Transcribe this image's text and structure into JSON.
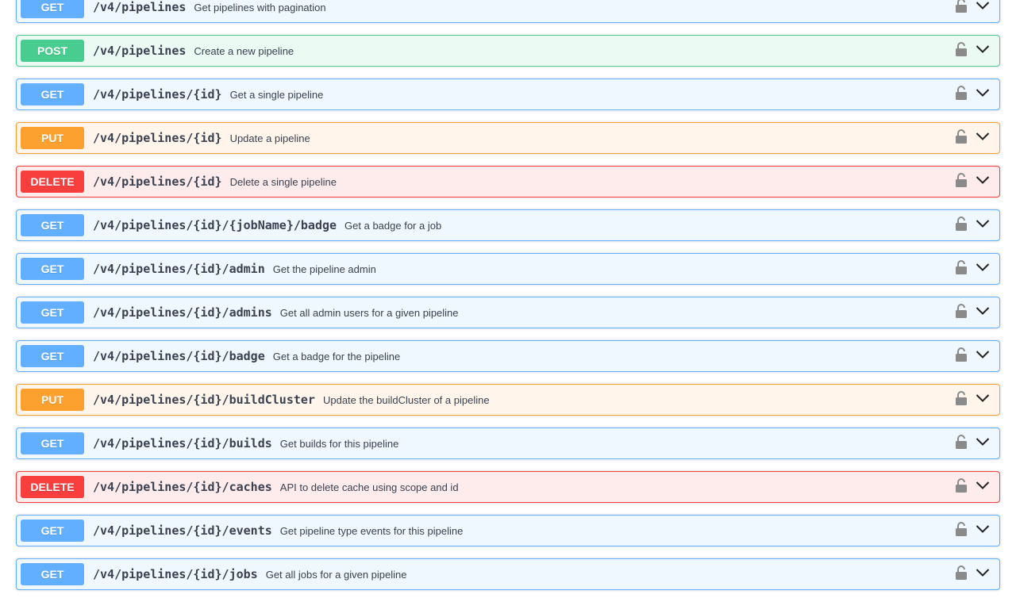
{
  "operations": [
    {
      "method": "GET",
      "path": "/v4/pipelines",
      "summary": "Get pipelines with pagination",
      "lock_icon": "unlocked-icon",
      "expand_icon": "chevron-down-icon"
    },
    {
      "method": "POST",
      "path": "/v4/pipelines",
      "summary": "Create a new pipeline",
      "lock_icon": "unlocked-icon",
      "expand_icon": "chevron-down-icon"
    },
    {
      "method": "GET",
      "path": "/v4/pipelines/{id}",
      "summary": "Get a single pipeline",
      "lock_icon": "unlocked-icon",
      "expand_icon": "chevron-down-icon"
    },
    {
      "method": "PUT",
      "path": "/v4/pipelines/{id}",
      "summary": "Update a pipeline",
      "lock_icon": "unlocked-icon",
      "expand_icon": "chevron-down-icon"
    },
    {
      "method": "DELETE",
      "path": "/v4/pipelines/{id}",
      "summary": "Delete a single pipeline",
      "lock_icon": "unlocked-icon",
      "expand_icon": "chevron-down-icon"
    },
    {
      "method": "GET",
      "path": "/v4/pipelines/{id}/{jobName}/badge",
      "summary": "Get a badge for a job",
      "lock_icon": "unlocked-icon",
      "expand_icon": "chevron-down-icon"
    },
    {
      "method": "GET",
      "path": "/v4/pipelines/{id}/admin",
      "summary": "Get the pipeline admin",
      "lock_icon": "unlocked-icon",
      "expand_icon": "chevron-down-icon"
    },
    {
      "method": "GET",
      "path": "/v4/pipelines/{id}/admins",
      "summary": "Get all admin users for a given pipeline",
      "lock_icon": "unlocked-icon",
      "expand_icon": "chevron-down-icon"
    },
    {
      "method": "GET",
      "path": "/v4/pipelines/{id}/badge",
      "summary": "Get a badge for the pipeline",
      "lock_icon": "unlocked-icon",
      "expand_icon": "chevron-down-icon"
    },
    {
      "method": "PUT",
      "path": "/v4/pipelines/{id}/buildCluster",
      "summary": "Update the buildCluster of a pipeline",
      "lock_icon": "unlocked-icon",
      "expand_icon": "chevron-down-icon"
    },
    {
      "method": "GET",
      "path": "/v4/pipelines/{id}/builds",
      "summary": "Get builds for this pipeline",
      "lock_icon": "unlocked-icon",
      "expand_icon": "chevron-down-icon"
    },
    {
      "method": "DELETE",
      "path": "/v4/pipelines/{id}/caches",
      "summary": "API to delete cache using scope and id",
      "lock_icon": "unlocked-icon",
      "expand_icon": "chevron-down-icon"
    },
    {
      "method": "GET",
      "path": "/v4/pipelines/{id}/events",
      "summary": "Get pipeline type events for this pipeline",
      "lock_icon": "unlocked-icon",
      "expand_icon": "chevron-down-icon"
    },
    {
      "method": "GET",
      "path": "/v4/pipelines/{id}/jobs",
      "summary": "Get all jobs for a given pipeline",
      "lock_icon": "unlocked-icon",
      "expand_icon": "chevron-down-icon"
    }
  ],
  "colors": {
    "get": "#61affe",
    "post": "#49cc90",
    "put": "#fca130",
    "delete": "#f93e3e",
    "text": "#3b4151"
  }
}
